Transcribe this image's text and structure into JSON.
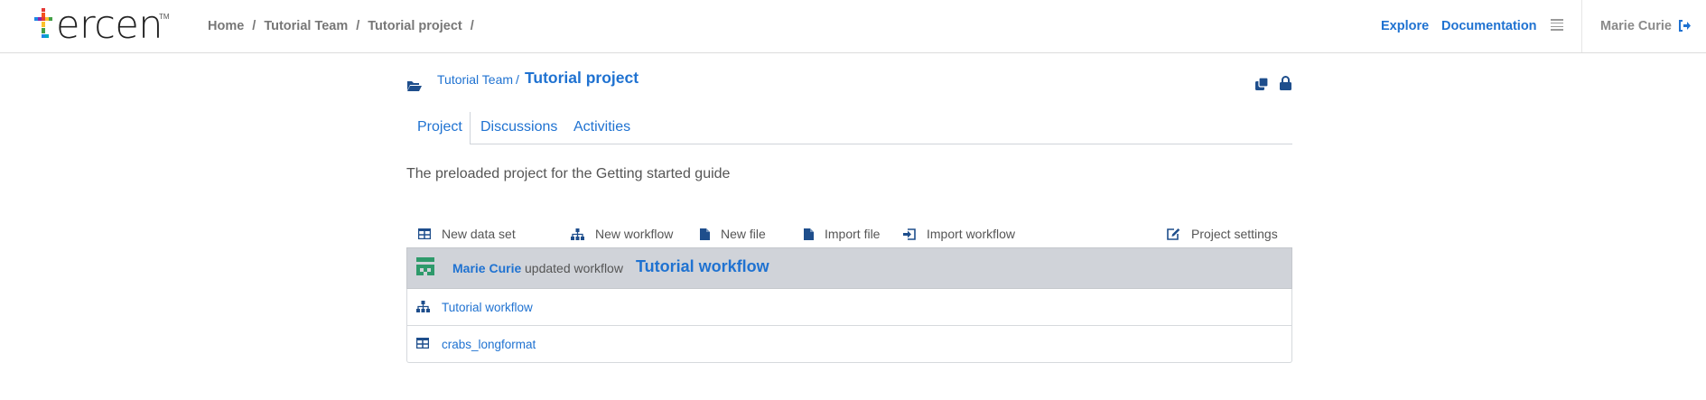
{
  "brand": {
    "name": "ercen",
    "tm": "TM"
  },
  "breadcrumb": {
    "items": [
      "Home",
      "Tutorial Team",
      "Tutorial project"
    ],
    "separator": "/"
  },
  "nav": {
    "explore": "Explore",
    "documentation": "Documentation",
    "menu_icon": "menu-icon",
    "user": "Marie Curie",
    "logout_icon": "logout-icon"
  },
  "project_header": {
    "folder_icon": "folder-open-icon",
    "team": "Tutorial Team",
    "separator": "/",
    "project": "Tutorial project",
    "copy_icon": "copy-icon",
    "lock_icon": "lock-icon"
  },
  "tabs": [
    {
      "label": "Project",
      "active": true
    },
    {
      "label": "Discussions",
      "active": false
    },
    {
      "label": "Activities",
      "active": false
    }
  ],
  "description": "The preloaded project for the Getting started guide",
  "actions": [
    {
      "label": "New data set",
      "icon": "table-icon"
    },
    {
      "label": "New workflow",
      "icon": "sitemap-icon"
    },
    {
      "label": "New file",
      "icon": "file-icon"
    },
    {
      "label": "Import file",
      "icon": "file-icon"
    },
    {
      "label": "Import workflow",
      "icon": "import-icon"
    },
    {
      "label": "Project settings",
      "icon": "edit-icon"
    }
  ],
  "activity": {
    "icon": "workflow-avatar-icon",
    "user": "Marie Curie",
    "verb": "updated workflow",
    "target": "Tutorial workflow"
  },
  "items": [
    {
      "label": "Tutorial workflow",
      "icon": "sitemap-icon"
    },
    {
      "label": "crabs_longformat",
      "icon": "table-icon"
    }
  ],
  "colors": {
    "link": "#1f72d1",
    "icon": "#1e4e8c",
    "activity_bg": "#d0d3d9",
    "avatar": "#2e9a6b",
    "logo_cross": [
      "#e53935",
      "#fbc02d",
      "#43a047",
      "#1e88e5",
      "#8e24aa",
      "#f4511e"
    ]
  }
}
